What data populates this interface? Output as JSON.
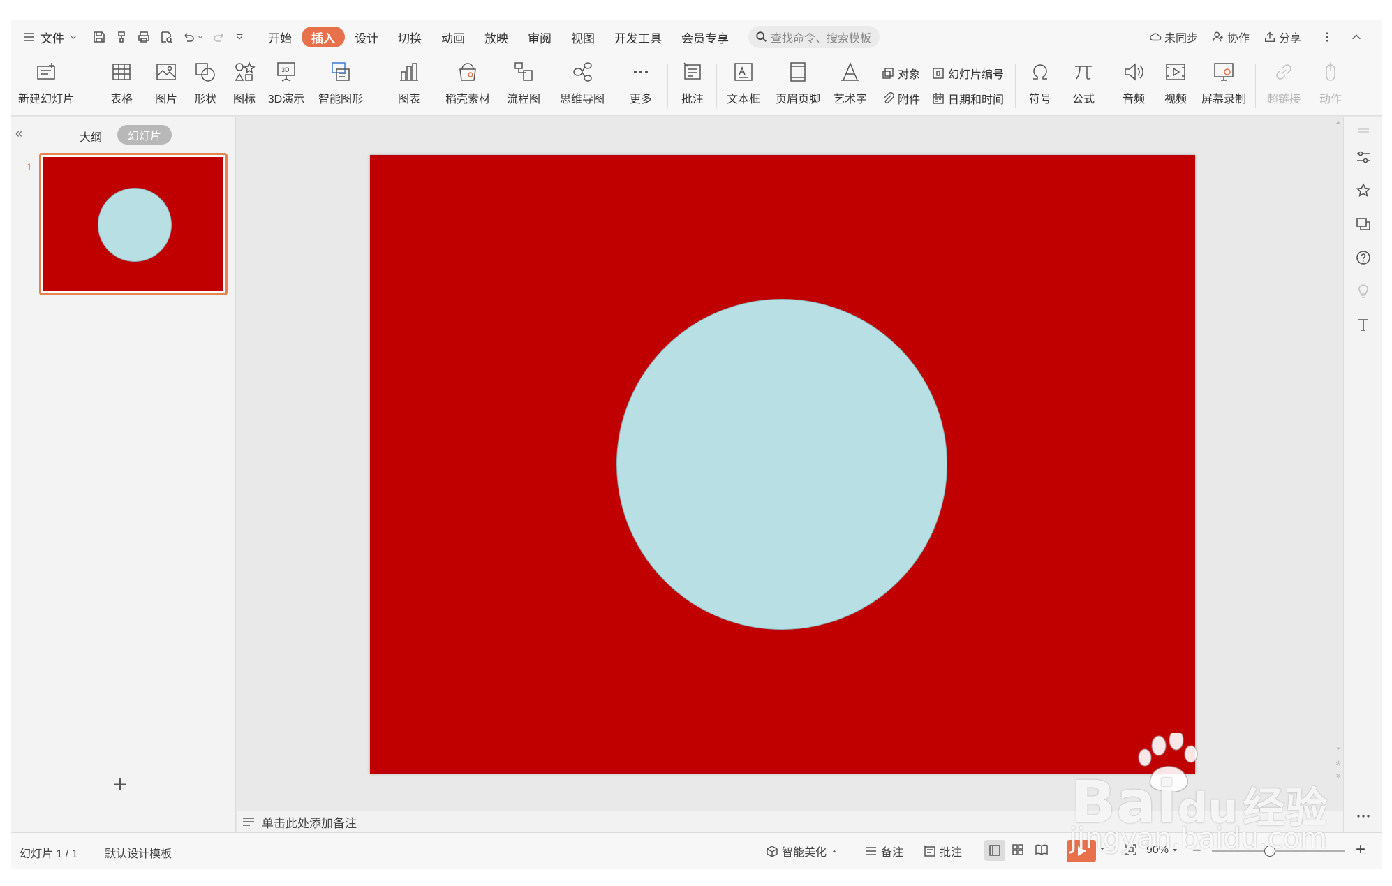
{
  "topbar": {
    "file_label": "文件",
    "tabs": [
      {
        "label": "开始"
      },
      {
        "label": "插入",
        "active": true
      },
      {
        "label": "设计"
      },
      {
        "label": "切换"
      },
      {
        "label": "动画"
      },
      {
        "label": "放映"
      },
      {
        "label": "审阅"
      },
      {
        "label": "视图"
      },
      {
        "label": "开发工具"
      },
      {
        "label": "会员专享"
      }
    ],
    "search_placeholder": "查找命令、搜索模板",
    "sync_label": "未同步",
    "collab_label": "协作",
    "share_label": "分享"
  },
  "ribbon": {
    "new_slide": "新建幻灯片",
    "table": "表格",
    "picture": "图片",
    "shape": "形状",
    "icon": "图标",
    "demo3d": "3D演示",
    "smartart": "智能图形",
    "chart": "图表",
    "docer": "稻壳素材",
    "flowchart": "流程图",
    "mindmap": "思维导图",
    "more": "更多",
    "comment": "批注",
    "textbox": "文本框",
    "header_footer": "页眉页脚",
    "wordart": "艺术字",
    "object": "对象",
    "attachment": "附件",
    "slide_number": "幻灯片编号",
    "date_time": "日期和时间",
    "symbol": "符号",
    "formula": "公式",
    "audio": "音频",
    "video": "视频",
    "screen_record": "屏幕录制",
    "hyperlink": "超链接",
    "action": "动作"
  },
  "left_panel": {
    "outline_tab": "大纲",
    "slides_tab": "幻灯片",
    "slide_index": "1"
  },
  "slide": {
    "background_color": "#c00000",
    "circle_color": "#b8dfe3"
  },
  "notes_placeholder": "单击此处添加备注",
  "status": {
    "slide_count": "幻灯片 1 / 1",
    "template": "默认设计模板",
    "beautify": "智能美化",
    "notes": "备注",
    "comment": "批注",
    "zoom": "90%"
  },
  "watermark": {
    "brand": "Bai",
    "brand2": "经验",
    "url": "jingyan.baidu.com"
  }
}
